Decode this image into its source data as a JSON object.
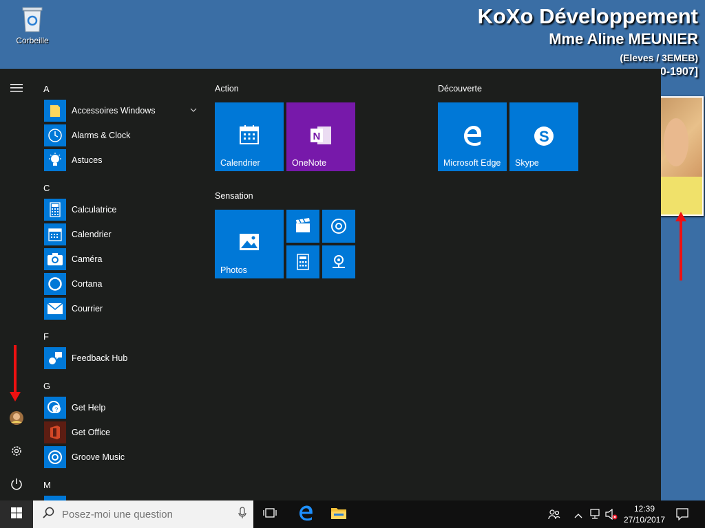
{
  "desktop": {
    "recycle_bin_label": "Corbeille",
    "overlay": {
      "line1": "KoXo Développement",
      "line2": "Mme Aline MEUNIER",
      "line3": "(Eleves / 3EMEB)",
      "line4": "0-1907]"
    }
  },
  "start_menu": {
    "rail": {
      "menu_icon": "hamburger-icon",
      "user_icon": "user-avatar",
      "settings_icon": "gear-icon",
      "power_icon": "power-icon"
    },
    "app_list": {
      "letter_a": "A",
      "letter_c": "C",
      "letter_f": "F",
      "letter_g": "G",
      "letter_m": "M",
      "apps": [
        {
          "label": "Accessoires Windows",
          "icon": "folder-icon"
        },
        {
          "label": "Alarms & Clock",
          "icon": "clock-icon"
        },
        {
          "label": "Astuces",
          "icon": "lightbulb-icon"
        },
        {
          "label": "Calculatrice",
          "icon": "calculator-icon"
        },
        {
          "label": "Calendrier",
          "icon": "calendar-icon"
        },
        {
          "label": "Caméra",
          "icon": "camera-icon"
        },
        {
          "label": "Cortana",
          "icon": "cortana-icon"
        },
        {
          "label": "Courrier",
          "icon": "mail-icon"
        },
        {
          "label": "Feedback Hub",
          "icon": "feedback-icon"
        },
        {
          "label": "Get Help",
          "icon": "help-icon"
        },
        {
          "label": "Get Office",
          "icon": "office-icon"
        },
        {
          "label": "Groove Music",
          "icon": "music-icon"
        }
      ]
    },
    "groups": {
      "action": "Action",
      "decouverte": "Découverte",
      "sensation": "Sensation"
    },
    "tiles": {
      "calendrier": "Calendrier",
      "onenote": "OneNote",
      "edge": "Microsoft Edge",
      "skype": "Skype",
      "photos": "Photos"
    },
    "colors": {
      "tile_blue": "#0078d7",
      "onenote_purple": "#7719aa",
      "office_red": "#5c1d12",
      "menu_bg": "#1c1e1c"
    }
  },
  "taskbar": {
    "search_placeholder": "Posez-moi une question",
    "clock_time": "12:39",
    "clock_date": "27/10/2017"
  }
}
